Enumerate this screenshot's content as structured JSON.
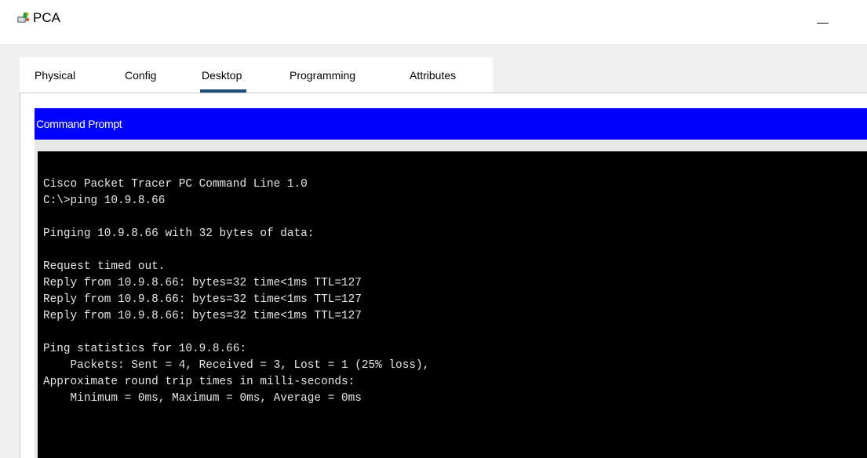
{
  "window": {
    "title": "PCA",
    "icon": "packet-tracer-pc-icon"
  },
  "tabs": [
    {
      "label": "Physical",
      "active": false
    },
    {
      "label": "Config",
      "active": false
    },
    {
      "label": "Desktop",
      "active": true
    },
    {
      "label": "Programming",
      "active": false
    },
    {
      "label": "Attributes",
      "active": false
    }
  ],
  "command_prompt": {
    "header": "Command Prompt",
    "header_color": "#0000ff",
    "terminal_bg": "#000000",
    "lines": [
      "Cisco Packet Tracer PC Command Line 1.0",
      "C:\\>ping 10.9.8.66",
      "",
      "Pinging 10.9.8.66 with 32 bytes of data:",
      "",
      "Request timed out.",
      "Reply from 10.9.8.66: bytes=32 time<1ms TTL=127",
      "Reply from 10.9.8.66: bytes=32 time<1ms TTL=127",
      "Reply from 10.9.8.66: bytes=32 time<1ms TTL=127",
      "",
      "Ping statistics for 10.9.8.66:",
      "    Packets: Sent = 4, Received = 3, Lost = 1 (25% loss),",
      "Approximate round trip times in milli-seconds:",
      "    Minimum = 0ms, Maximum = 0ms, Average = 0ms"
    ]
  }
}
